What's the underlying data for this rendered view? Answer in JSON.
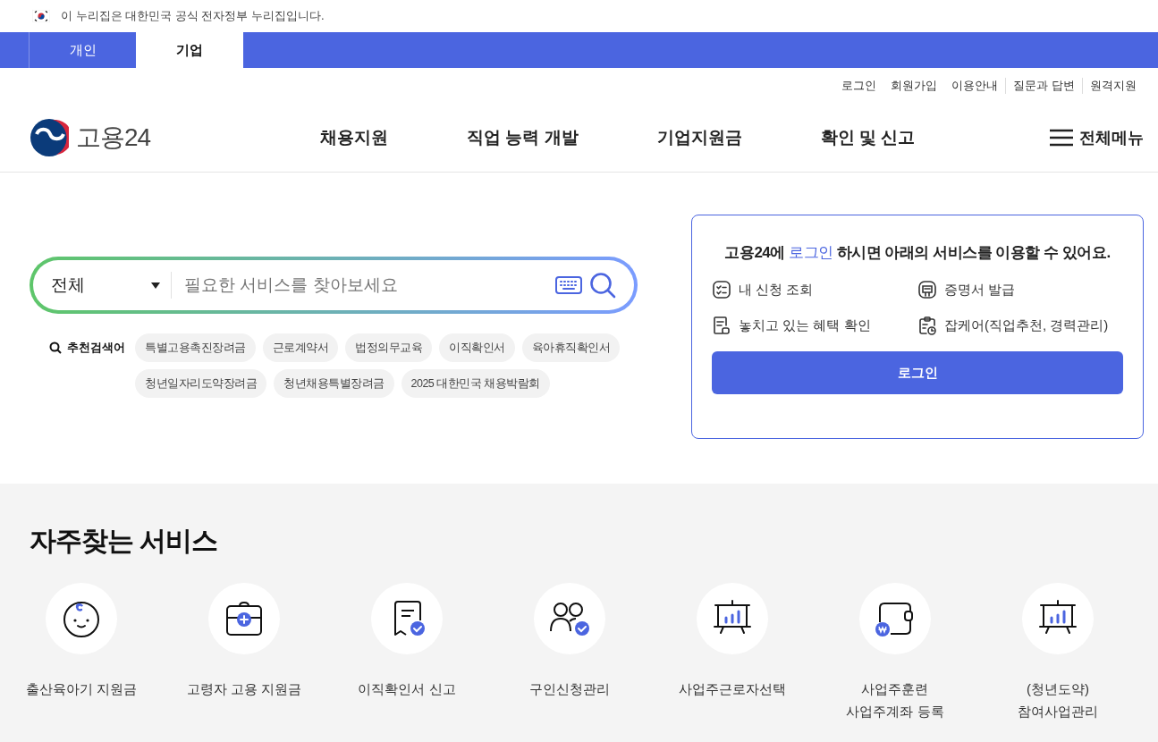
{
  "gov_banner": {
    "text": "이 누리집은 대한민국 공식 전자정부 누리집입니다."
  },
  "site_tabs": [
    {
      "label": "개인",
      "selected": false
    },
    {
      "label": "기업",
      "selected": true
    }
  ],
  "util_links": [
    "로그인",
    "회원가입",
    "이용안내",
    "질문과 답변",
    "원격지원"
  ],
  "header": {
    "logo_text": "고용24",
    "nav": [
      "채용지원",
      "직업 능력 개발",
      "기업지원금",
      "확인 및 신고"
    ],
    "all_menu": "전체메뉴"
  },
  "search": {
    "category": "전체",
    "placeholder": "필요한 서비스를 찾아보세요",
    "recommended_label": "추천검색어",
    "recommended": [
      "특별고용촉진장려금",
      "근로계약서",
      "법정의무교육",
      "이직확인서",
      "육아휴직확인서",
      "청년일자리도약장려금",
      "청년채용특별장려금",
      "2025 대한민국 채용박람회"
    ]
  },
  "login_card": {
    "title_before": "고용24에",
    "title_link": "로그인",
    "title_after": "하시면 아래의 서비스를 이용할 수 있어요.",
    "features": [
      {
        "kind": "list",
        "label": "내 신청 조회"
      },
      {
        "kind": "certificate",
        "label": "증명서 발급"
      },
      {
        "kind": "receipt",
        "label": "놓치고 있는 혜택 확인"
      },
      {
        "kind": "clipboard",
        "label": "잡케어(직업추천, 경력관리)"
      }
    ],
    "button": "로그인"
  },
  "services": {
    "title": "자주찾는 서비스",
    "items": [
      {
        "kind": "baby",
        "label": "출산육아기 지원금"
      },
      {
        "kind": "briefcase",
        "label": "고령자 고용 지원금"
      },
      {
        "kind": "document",
        "label": "이직확인서 신고"
      },
      {
        "kind": "people",
        "label": "구인신청관리"
      },
      {
        "kind": "easel",
        "label": "사업주근로자선택"
      },
      {
        "kind": "wallet",
        "label": "사업주훈련\n사업주계좌 등록"
      },
      {
        "kind": "easel",
        "label": "(청년도약)\n참여사업관리"
      }
    ]
  }
}
